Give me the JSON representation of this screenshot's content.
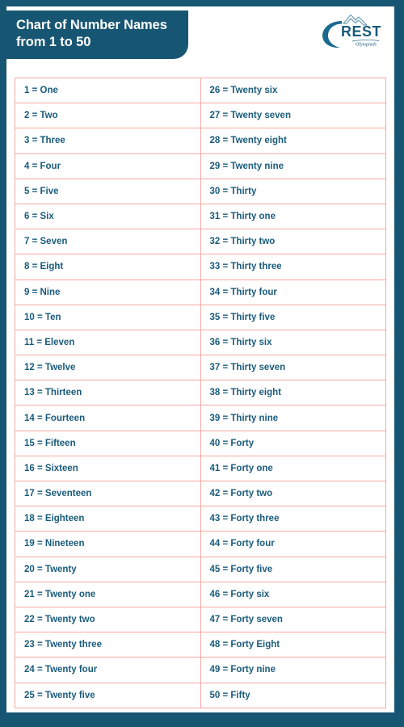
{
  "header": {
    "title_line1": "Chart of Number Names",
    "title_line2": "from 1 to 50",
    "logo": {
      "name": "crest-olympiads-logo",
      "brand_main": "REST",
      "brand_initial": "C",
      "brand_sub": "Olympiads"
    }
  },
  "colors": {
    "frame": "#175673",
    "banner": "#175673",
    "cell_border": "#f7a8a3",
    "cell_text": "#1a5b7b",
    "sheet": "#ffffff"
  },
  "table": {
    "rows": 25,
    "columns": 2,
    "left_column": [
      "1 = One",
      "2 = Two",
      "3 = Three",
      "4 = Four",
      "5 = Five",
      "6 = Six",
      "7 = Seven",
      "8 = Eight",
      "9 = Nine",
      "10 = Ten",
      "11 = Eleven",
      "12 = Twelve",
      "13 = Thirteen",
      "14 = Fourteen",
      "15 = Fifteen",
      "16 = Sixteen",
      "17 = Seventeen",
      "18 = Eighteen",
      "19 = Nineteen",
      "20 = Twenty",
      "21 = Twenty one",
      "22 = Twenty two",
      "23 = Twenty three",
      "24 = Twenty four",
      "25 = Twenty five"
    ],
    "right_column": [
      "26 = Twenty six",
      "27 = Twenty seven",
      "28 = Twenty eight",
      "29 = Twenty nine",
      "30 = Thirty",
      "31 = Thirty one",
      "32 = Thirty two",
      "33 = Thirty three",
      "34 = Thirty four",
      "35 = Thirty five",
      "36 = Thirty six",
      "37 = Thirty seven",
      "38 = Thirty eight",
      "39 = Thirty nine",
      "40 = Forty",
      "41 = Forty one",
      "42 = Forty two",
      "43 = Forty three",
      "44 = Forty four",
      "45 = Forty five",
      "46 = Forty six",
      "47 = Forty seven",
      "48 = Forty Eight",
      "49 = Forty nine",
      "50 = Fifty"
    ]
  }
}
